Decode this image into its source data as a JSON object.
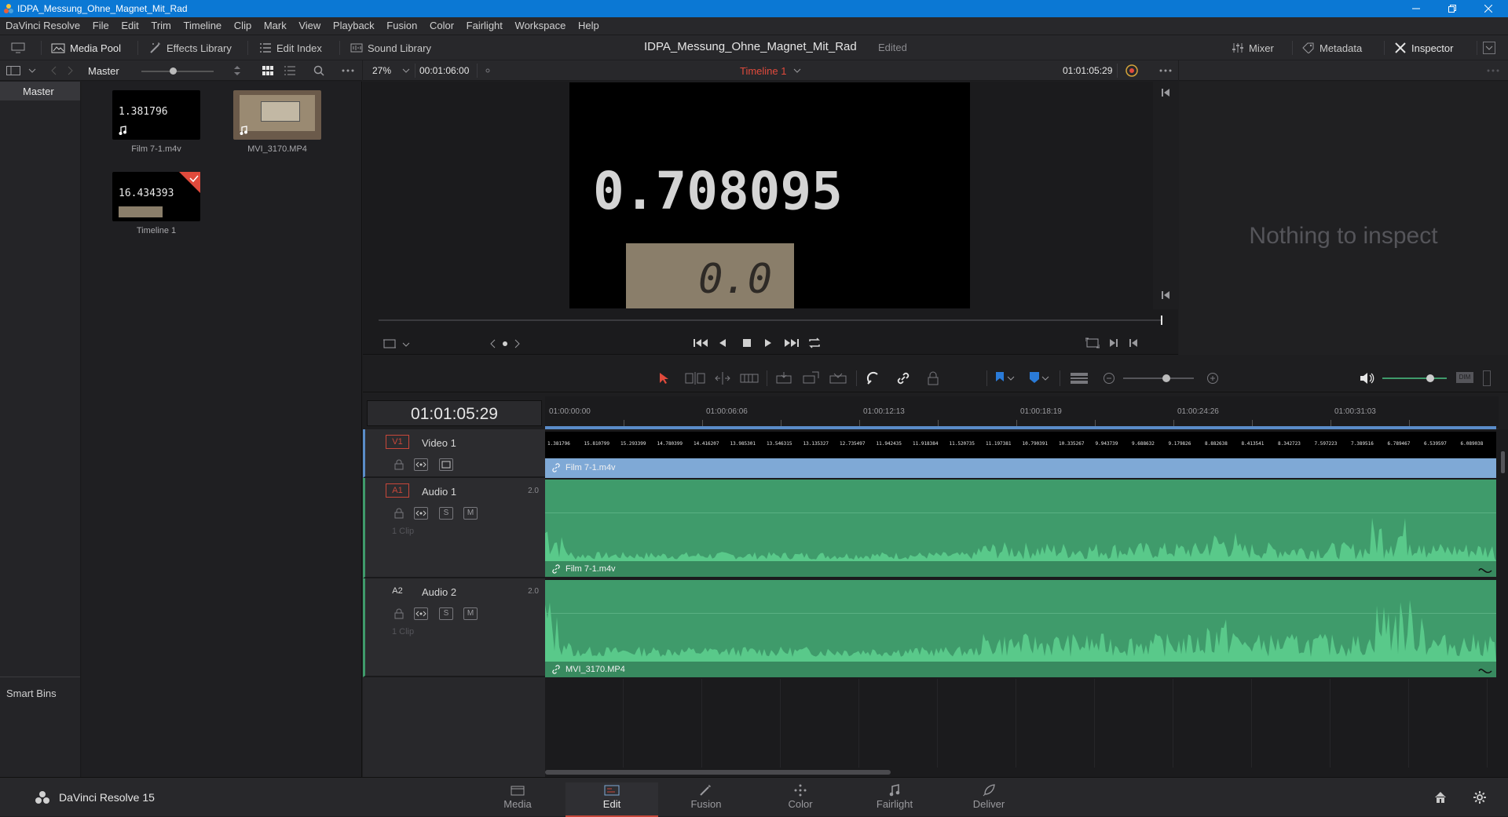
{
  "window": {
    "title": "IDPA_Messung_Ohne_Magnet_Mit_Rad"
  },
  "menu": [
    "DaVinci Resolve",
    "File",
    "Edit",
    "Trim",
    "Timeline",
    "Clip",
    "Mark",
    "View",
    "Playback",
    "Fusion",
    "Color",
    "Fairlight",
    "Workspace",
    "Help"
  ],
  "toolbar": {
    "media_pool": "Media Pool",
    "effects_library": "Effects Library",
    "edit_index": "Edit Index",
    "sound_library": "Sound Library",
    "project_title": "IDPA_Messung_Ohne_Magnet_Mit_Rad",
    "edited": "Edited",
    "mixer": "Mixer",
    "metadata": "Metadata",
    "inspector": "Inspector"
  },
  "pool": {
    "bin_label": "Master",
    "sidebar_master": "Master",
    "smart_bins": "Smart Bins",
    "clips": [
      {
        "name": "Film 7-1.m4v",
        "thumb_text": "1.381796"
      },
      {
        "name": "MVI_3170.MP4",
        "thumb_text": ""
      },
      {
        "name": "Timeline 1",
        "thumb_text": "16.434393"
      }
    ]
  },
  "viewer": {
    "zoom": "27%",
    "duration": "00:01:06:00",
    "timeline_name": "Timeline 1",
    "timecode": "01:01:05:29",
    "frame_value": "0.708095",
    "inset_digits": "0.0"
  },
  "inspector": {
    "empty_text": "Nothing to inspect"
  },
  "timeline": {
    "timecode": "01:01:05:29",
    "ruler": [
      "01:00:00:00",
      "01:00:06:06",
      "01:00:12:13",
      "01:00:18:19",
      "01:00:24:26",
      "01:00:31:03"
    ],
    "video_strip_values": [
      "1.381796",
      "15.810799",
      "15.293399",
      "14.780399",
      "14.416207",
      "13.985301",
      "13.546315",
      "13.135327",
      "12.735497",
      "11.942435",
      "11.918384",
      "11.520735",
      "11.197381",
      "10.790391",
      "10.335267",
      "9.943739",
      "9.688632",
      "9.179826",
      "8.882638",
      "8.413541",
      "8.342723",
      "7.597223",
      "7.389516",
      "6.789467",
      "6.539597",
      "6.089038"
    ],
    "tracks": [
      {
        "id": "V1",
        "name": "Video 1",
        "channels": "",
        "clip": "Film 7-1.m4v",
        "clips_count": ""
      },
      {
        "id": "A1",
        "name": "Audio 1",
        "channels": "2.0",
        "clip": "Film 7-1.m4v",
        "clips_count": "1 Clip"
      },
      {
        "id": "A2",
        "name": "Audio 2",
        "channels": "2.0",
        "clip": "MVI_3170.MP4",
        "clips_count": "1 Clip"
      }
    ],
    "solo": "S",
    "mute": "M"
  },
  "footer": {
    "app_name": "DaVinci Resolve 15",
    "pages": [
      "Media",
      "Edit",
      "Fusion",
      "Color",
      "Fairlight",
      "Deliver"
    ],
    "active_page": "Edit"
  },
  "colors": {
    "accent_red": "#c8473a",
    "video_clip": "#7fa9d6",
    "audio_clip": "#3f9b6b",
    "titlebar": "#0b78d4"
  }
}
